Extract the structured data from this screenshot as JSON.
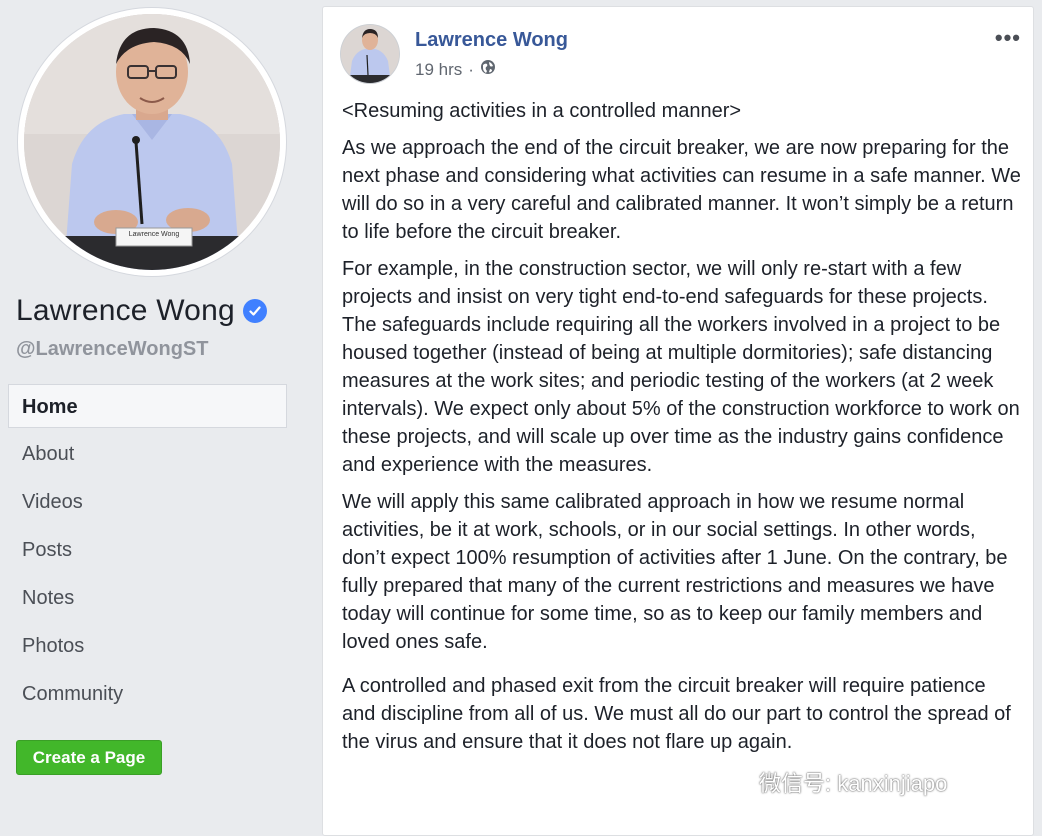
{
  "profile": {
    "name": "Lawrence Wong",
    "handle": "@LawrenceWongST",
    "avatar_caption": "Lawrence Wong"
  },
  "nav": {
    "items": [
      {
        "label": "Home",
        "active": true
      },
      {
        "label": "About"
      },
      {
        "label": "Videos"
      },
      {
        "label": "Posts"
      },
      {
        "label": "Notes"
      },
      {
        "label": "Photos"
      },
      {
        "label": "Community"
      }
    ],
    "create_page_label": "Create a Page"
  },
  "post": {
    "author": "Lawrence Wong",
    "time": "19 hrs",
    "separator": "·",
    "more_label": "•••",
    "paragraphs": [
      "<Resuming activities in a controlled manner>",
      "As we approach the end of the circuit breaker, we are now preparing for the next phase and considering what activities can resume in a safe manner. We will do so in a very careful and calibrated manner. It won’t simply be a return to life before the circuit breaker.",
      "For example, in the construction sector, we will only re-start with a few projects and insist on very tight end-to-end safeguards for these projects. The safeguards include requiring all the workers involved in a project to be housed together (instead of being at multiple dormitories); safe distancing measures at the work sites; and periodic testing of the workers (at 2 week intervals). We expect only about 5% of the construction workforce to work on these projects, and will scale up over time as the industry gains confidence and experience with the measures.",
      "We will apply this same calibrated approach in how we resume normal activities, be it at work, schools, or in our social settings. In other words, don’t expect 100% resumption of activities after 1 June. On the contrary, be fully prepared that many of the current restrictions and measures we have today will continue for some time, so as to keep our family members and loved ones safe.",
      "A controlled and phased exit from the circuit breaker will require patience and discipline from all of us. We must all do our part to control the spread of the virus and ensure that it does not flare up again."
    ]
  },
  "watermark": {
    "text": "微信号: kanxinjiapo"
  },
  "colors": {
    "page_bg": "#e9ebee",
    "link_blue": "#385898",
    "verified_blue": "#4080ff",
    "create_green": "#42b72a"
  }
}
